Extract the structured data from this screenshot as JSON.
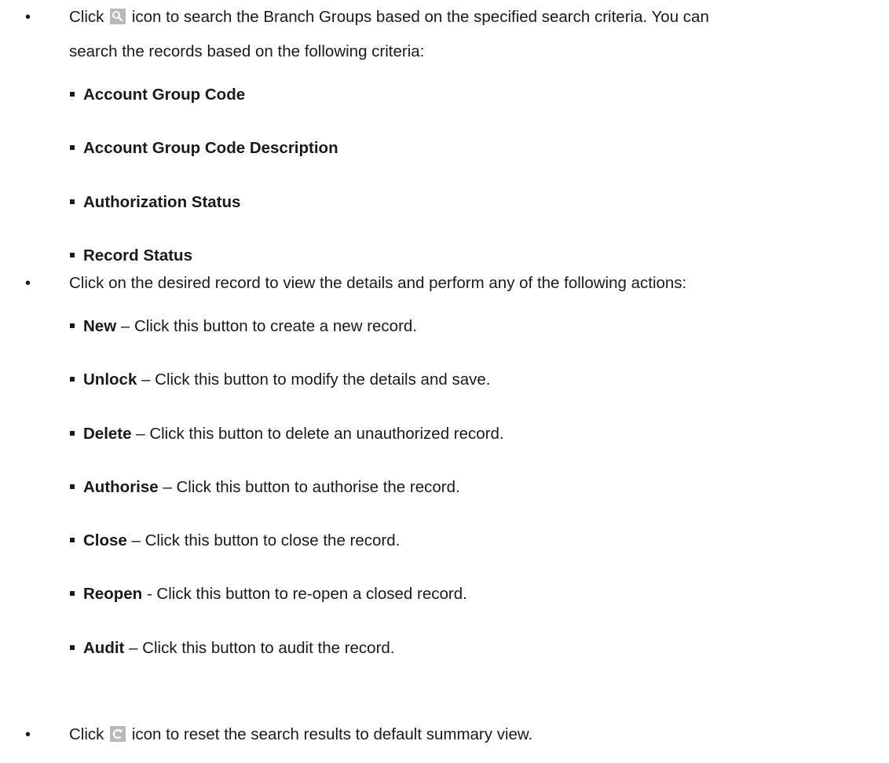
{
  "items": {
    "search": {
      "bullet": "•",
      "before": "Click",
      "icon": "search-icon",
      "after": "icon to search the Branch Groups based on the specified search criteria. You can",
      "cont": "search the records based on the following criteria:",
      "criteria": [
        "Account Group Code",
        "Account Group Code Description",
        "Authorization Status",
        "Record Status"
      ]
    },
    "record": {
      "bullet": "•",
      "text": "Click on the desired record to view the details and perform any of the following actions:",
      "actions": [
        {
          "label": "New",
          "desc": " – Click this button to create a new record."
        },
        {
          "label": "Unlock",
          "desc": " – Click this button to modify the details and save."
        },
        {
          "label": "Delete",
          "desc": " – Click this button to delete an unauthorized record."
        },
        {
          "label": "Authorise",
          "desc": " – Click this button to authorise the record."
        },
        {
          "label": "Close",
          "desc": " – Click this button to close the record."
        },
        {
          "label": "Reopen",
          "desc": " - Click this button to re-open a closed record."
        },
        {
          "label": "Audit",
          "desc": " – Click this button to audit the record."
        }
      ]
    },
    "reset": {
      "bullet": "•",
      "before": "Click",
      "icon": "reset-icon",
      "after": "icon to reset the search results to default summary view."
    }
  }
}
